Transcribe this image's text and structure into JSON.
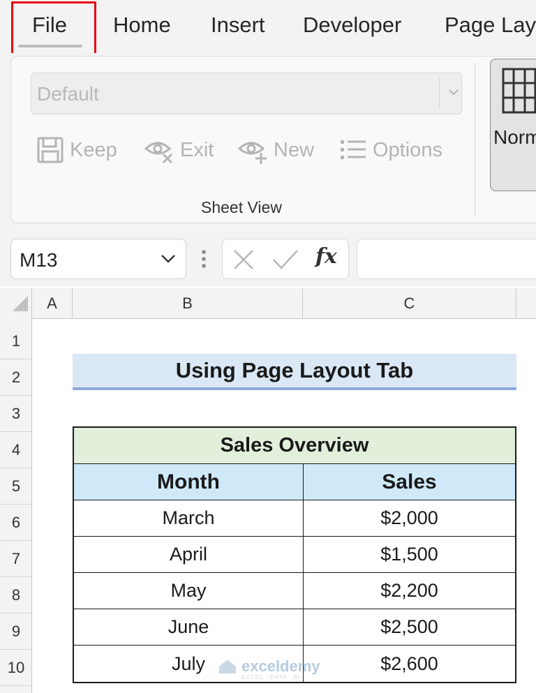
{
  "menu": {
    "tabs": [
      "File",
      "Home",
      "Insert",
      "Developer",
      "Page Lay"
    ]
  },
  "ribbon": {
    "sheet_view_select": "Default",
    "buttons": {
      "keep": "Keep",
      "exit": "Exit",
      "new": "New",
      "options": "Options"
    },
    "group_label": "Sheet View",
    "normal_label": "Norm"
  },
  "formula_bar": {
    "name_box": "M13",
    "fx_label": "fx",
    "formula": ""
  },
  "grid": {
    "columns": [
      "A",
      "B",
      "C"
    ],
    "rows": [
      "1",
      "2",
      "3",
      "4",
      "5",
      "6",
      "7",
      "8",
      "9",
      "10"
    ]
  },
  "sheet": {
    "title": "Using Page Layout Tab",
    "table": {
      "caption": "Sales Overview",
      "headers": [
        "Month",
        "Sales"
      ],
      "rows": [
        [
          "March",
          "$2,000"
        ],
        [
          "April",
          "$1,500"
        ],
        [
          "May",
          "$2,200"
        ],
        [
          "June",
          "$2,500"
        ],
        [
          "July",
          "$2,600"
        ]
      ]
    }
  },
  "watermark": {
    "name": "exceldemy",
    "tagline": "EXCEL · DATA · BI"
  },
  "colors": {
    "highlight_border": "#e8000d",
    "title_fill": "#dae7f5",
    "caption_fill": "#e2efda",
    "header_fill": "#cfe9f9"
  }
}
